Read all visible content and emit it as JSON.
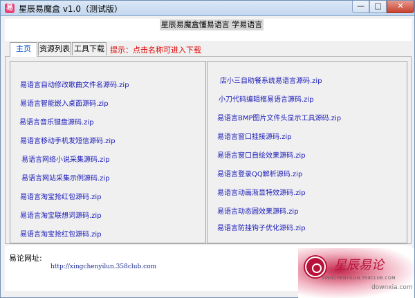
{
  "window": {
    "title": "星辰易魔盒 v1.0（测试版）",
    "min_glyph": "—",
    "max_glyph": "□",
    "close_glyph": "✕"
  },
  "header": {
    "headline": "星辰易魔盒懂易语言 学易语言"
  },
  "tabs": [
    {
      "label": "主页",
      "active": true
    },
    {
      "label": "资源列表",
      "active": false
    },
    {
      "label": "工具下载",
      "active": false
    }
  ],
  "hint": "提示：点击名称可进入下载",
  "left_links": [
    "易语言自动修改歌曲文件名源码.zip",
    "易语言智能嵌入桌面源码.zip",
    "易语言音乐键盘源码.zip",
    "易语言移动手机发短信源码.zip",
    "易语言网络小说采集源码.zip",
    "易语言网站采集示例源码.zip",
    "易语言淘宝抢红包源码.zip",
    "易语言淘宝联想词源码.zip",
    "易语言淘宝抢红包源码.zip"
  ],
  "right_links": [
    "店小三自助餐系统易语言源码.zip",
    "小刀代码编辑框易语言源码.zip",
    "易语言BMP图片文件头显示工具源码.zip",
    "易语言窗口挂接源码.zip",
    "易语言窗口自绘效果源码.zip",
    "易语言登录QQ解析源码.zip",
    "易语言动画渐显特效源码.zip",
    "易语言动态圆效果源码.zip",
    "易语言防挂钩子优化源码.zip"
  ],
  "footer": {
    "forum_label": "易论网址:",
    "forum_url": "http://xingchenyilun.358club.com"
  },
  "logo": {
    "title": "星辰易论",
    "subtitle": "XINGCHENYILUN.358CLUB.COM",
    "watermark": "downxia.com"
  },
  "colors": {
    "link": "#1a1ab8",
    "hint": "#e00000",
    "active_tab": "#0a56c8",
    "brand": "#b8123a"
  }
}
